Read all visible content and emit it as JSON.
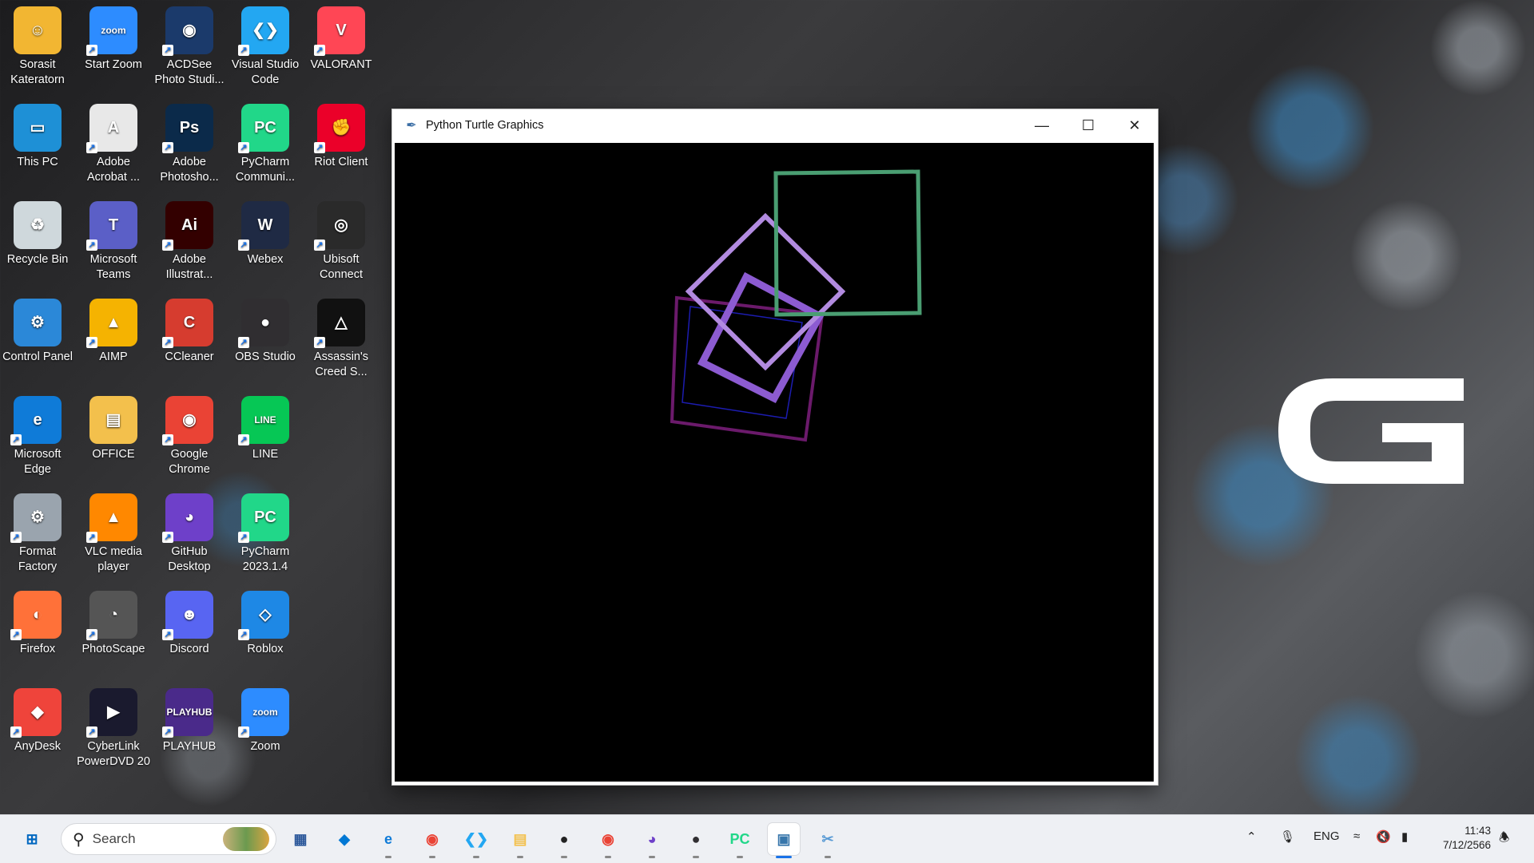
{
  "desktop": {
    "icons": [
      {
        "label": "Sorasit Kateratorn",
        "icon": "user-folder-icon",
        "color": "#f2b632",
        "glyph": "☺"
      },
      {
        "label": "Start Zoom",
        "icon": "zoom-icon",
        "color": "#2d8cff",
        "glyph": "zoom"
      },
      {
        "label": "ACDSee Photo Studi...",
        "icon": "acdsee-icon",
        "color": "#1b3a6b",
        "glyph": "◉"
      },
      {
        "label": "Visual Studio Code",
        "icon": "vscode-icon",
        "color": "#23a7f2",
        "glyph": "❮❯"
      },
      {
        "label": "VALORANT",
        "icon": "valorant-icon",
        "color": "#ff4655",
        "glyph": "V"
      },
      {
        "label": "This PC",
        "icon": "monitor-icon",
        "color": "#1e90d6",
        "glyph": "▭"
      },
      {
        "label": "Adobe Acrobat ...",
        "icon": "acrobat-icon",
        "color": "#e8e8e8",
        "glyph": "A"
      },
      {
        "label": "Adobe Photosho...",
        "icon": "photoshop-icon",
        "color": "#0b2a4a",
        "glyph": "Ps"
      },
      {
        "label": "PyCharm Communi...",
        "icon": "pycharm-icon",
        "color": "#21d789",
        "glyph": "PC"
      },
      {
        "label": "Riot Client",
        "icon": "riot-icon",
        "color": "#eb0029",
        "glyph": "✊"
      },
      {
        "label": "Recycle Bin",
        "icon": "recycle-bin-icon",
        "color": "#cfd8dc",
        "glyph": "♻"
      },
      {
        "label": "Microsoft Teams",
        "icon": "teams-icon",
        "color": "#5b5fc7",
        "glyph": "T"
      },
      {
        "label": "Adobe Illustrat...",
        "icon": "illustrator-icon",
        "color": "#330000",
        "glyph": "Ai"
      },
      {
        "label": "Webex",
        "icon": "webex-icon",
        "color": "#1f2a44",
        "glyph": "W"
      },
      {
        "label": "Ubisoft Connect",
        "icon": "ubisoft-icon",
        "color": "#2a2a2a",
        "glyph": "◎"
      },
      {
        "label": "Control Panel",
        "icon": "control-panel-icon",
        "color": "#2b88d8",
        "glyph": "⚙"
      },
      {
        "label": "AIMP",
        "icon": "aimp-icon",
        "color": "#f5b301",
        "glyph": "▲"
      },
      {
        "label": "CCleaner",
        "icon": "ccleaner-icon",
        "color": "#d63c2f",
        "glyph": "C"
      },
      {
        "label": "OBS Studio",
        "icon": "obs-icon",
        "color": "#302e31",
        "glyph": "●"
      },
      {
        "label": "Assassin's Creed S...",
        "icon": "assassins-creed-icon",
        "color": "#111111",
        "glyph": "△"
      },
      {
        "label": "Microsoft Edge",
        "icon": "edge-icon",
        "color": "#0f7bd8",
        "glyph": "e"
      },
      {
        "label": "OFFICE",
        "icon": "folder-icon",
        "color": "#f3c04c",
        "glyph": "▤"
      },
      {
        "label": "Google Chrome",
        "icon": "chrome-icon",
        "color": "#ea4335",
        "glyph": "◉"
      },
      {
        "label": "LINE",
        "icon": "line-icon",
        "color": "#06c755",
        "glyph": "LINE"
      },
      {
        "label": "Format Factory",
        "icon": "format-factory-icon",
        "color": "#9aa4ae",
        "glyph": "⚙"
      },
      {
        "label": "VLC media player",
        "icon": "vlc-icon",
        "color": "#ff8800",
        "glyph": "▲"
      },
      {
        "label": "GitHub Desktop",
        "icon": "github-icon",
        "color": "#6e40c9",
        "glyph": "◕"
      },
      {
        "label": "PyCharm 2023.1.4",
        "icon": "pycharm-icon",
        "color": "#21d789",
        "glyph": "PC"
      },
      {
        "label": "Firefox",
        "icon": "firefox-icon",
        "color": "#ff7139",
        "glyph": "◐"
      },
      {
        "label": "PhotoScape",
        "icon": "photoscape-icon",
        "color": "#555555",
        "glyph": "◔"
      },
      {
        "label": "Discord",
        "icon": "discord-icon",
        "color": "#5865f2",
        "glyph": "☻"
      },
      {
        "label": "Roblox",
        "icon": "roblox-icon",
        "color": "#1e88e5",
        "glyph": "◇"
      },
      {
        "label": "AnyDesk",
        "icon": "anydesk-icon",
        "color": "#ef443b",
        "glyph": "◆"
      },
      {
        "label": "CyberLink PowerDVD 20",
        "icon": "powerdvd-icon",
        "color": "#1a1a2e",
        "glyph": "▶"
      },
      {
        "label": "PLAYHUB",
        "icon": "playhub-icon",
        "color": "#4a2a8a",
        "glyph": "PLAYHUB"
      },
      {
        "label": "Zoom",
        "icon": "zoom-icon",
        "color": "#2d8cff",
        "glyph": "zoom"
      }
    ]
  },
  "window": {
    "title": "Python Turtle Graphics",
    "title_icon": "feather-icon",
    "canvas_background": "#000000",
    "shapes": [
      {
        "name": "green-square",
        "color": "#4a9e72"
      },
      {
        "name": "lavender-diamond",
        "color": "#b28be0"
      },
      {
        "name": "purple-square",
        "color": "#8c5bd1"
      },
      {
        "name": "magenta-square",
        "color": "#6b1a6b"
      },
      {
        "name": "blue-square",
        "color": "#1c1cb0"
      }
    ]
  },
  "taskbar": {
    "search_placeholder": "Search",
    "apps": [
      {
        "name": "start-button",
        "glyph": "⊞",
        "color": "#0067c0"
      },
      {
        "name": "microsoft-store",
        "glyph": "▦",
        "color": "#2b579a"
      },
      {
        "name": "windows-security",
        "glyph": "◆",
        "color": "#0078d4"
      },
      {
        "name": "edge",
        "glyph": "e",
        "color": "#0f7bd8"
      },
      {
        "name": "chrome",
        "glyph": "◉",
        "color": "#ea4335"
      },
      {
        "name": "vscode",
        "glyph": "❮❯",
        "color": "#23a7f2"
      },
      {
        "name": "file-explorer",
        "glyph": "▤",
        "color": "#f3c04c"
      },
      {
        "name": "alienware",
        "glyph": "●",
        "color": "#222222"
      },
      {
        "name": "chrome-profile",
        "glyph": "◉",
        "color": "#ea4335"
      },
      {
        "name": "github-desktop",
        "glyph": "◕",
        "color": "#6e40c9"
      },
      {
        "name": "obs",
        "glyph": "●",
        "color": "#302e31"
      },
      {
        "name": "pycharm",
        "glyph": "PC",
        "color": "#21d789"
      },
      {
        "name": "python",
        "glyph": "▣",
        "color": "#3776ab"
      },
      {
        "name": "snipping-tool",
        "glyph": "✂",
        "color": "#5a9bd5"
      }
    ],
    "tray": {
      "language": "ENG",
      "time": "11:43",
      "date": "7/12/2566"
    }
  }
}
